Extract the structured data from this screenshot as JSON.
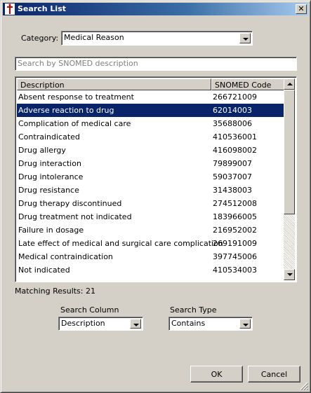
{
  "window": {
    "title": "Search List"
  },
  "category": {
    "label": "Category:",
    "value": "Medical Reason"
  },
  "search": {
    "placeholder": "Search by SNOMED description"
  },
  "table": {
    "columns": [
      "Description",
      "SNOMED Code"
    ],
    "rows": [
      [
        "Absent response to treatment",
        "266721009"
      ],
      [
        "Adverse reaction to drug",
        "62014003"
      ],
      [
        "Complication of medical care",
        "35688006"
      ],
      [
        "Contraindicated",
        "410536001"
      ],
      [
        "Drug allergy",
        "416098002"
      ],
      [
        "Drug interaction",
        "79899007"
      ],
      [
        "Drug intolerance",
        "59037007"
      ],
      [
        "Drug resistance",
        "31438003"
      ],
      [
        "Drug therapy discontinued",
        "274512008"
      ],
      [
        "Drug treatment not indicated",
        "183966005"
      ],
      [
        "Failure in dosage",
        "216952002"
      ],
      [
        "Late effect of medical and surgical care complication",
        "269191009"
      ],
      [
        "Medical contraindication",
        "397745006"
      ],
      [
        "Not indicated",
        "410534003"
      ]
    ],
    "selected_row": 1
  },
  "matching": {
    "text": "Matching Results: 21"
  },
  "search_column": {
    "label": "Search Column",
    "value": "Description"
  },
  "search_type": {
    "label": "Search Type",
    "value": "Contains"
  },
  "buttons": {
    "ok": "OK",
    "cancel": "Cancel"
  },
  "colors": {
    "selection": "#0a246a",
    "titlebar": "#0a246a",
    "face": "#d4d0c8"
  },
  "icons": {
    "title": "caduceus-icon",
    "close": "close-icon",
    "dropdown": "chevron-down-icon",
    "resize": "resize-grip-icon"
  }
}
